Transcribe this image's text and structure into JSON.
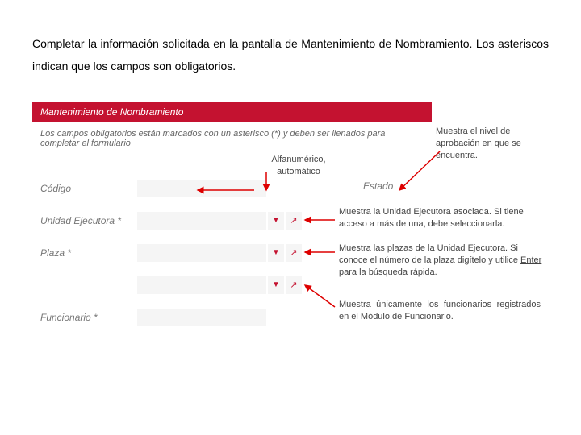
{
  "instruction": "Completar la información solicitada en la pantalla de Mantenimiento de Nombramiento. Los asteriscos indican que los campos son obligatorios.",
  "header": "Mantenimiento de Nombramiento",
  "form_hint": "Los campos obligatorios están marcados con un asterisco (*) y deben ser llenados para completar el formulario",
  "labels": {
    "codigo": "Código",
    "unidad": "Unidad Ejecutora *",
    "plaza": "Plaza *",
    "funcionario": "Funcionario *",
    "estado": "Estado"
  },
  "callouts": {
    "nivel": "Muestra el nivel de aprobación  en que se encuentra.",
    "alfa": "Alfanumérico, automático",
    "ue": "Muestra la Unidad Ejecutora asociada. Si tiene acceso a más de una, debe seleccionarla.",
    "plaza_a": "Muestra las plazas de la Unidad Ejecutora. Si conoce el número de la plaza digítelo y utilice ",
    "plaza_enter": "Enter",
    "plaza_b": " para la búsqueda rápida.",
    "func": "Muestra únicamente los funcionarios registrados en el  Módulo de Funcionario."
  },
  "icons": {
    "dropdown": "▼",
    "popup": "↗"
  }
}
